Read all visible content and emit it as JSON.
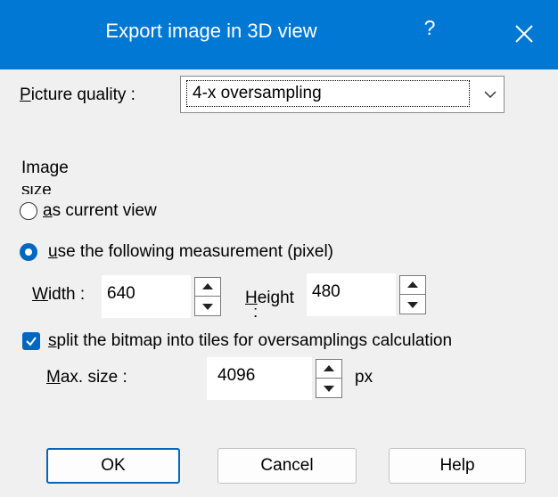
{
  "window": {
    "title": "Export image in 3D view",
    "help_glyph": "?",
    "close_icon": "close-icon",
    "accent_color": "#0078d4"
  },
  "picture_quality": {
    "label_prefix": "P",
    "label_rest": "icture quality :",
    "selected": "4-x oversampling"
  },
  "image_size": {
    "group_label": "Image",
    "group_label_cont": "size",
    "option_current": {
      "underlined": "a",
      "rest": "s current view",
      "selected": false
    },
    "option_measure": {
      "underlined": "u",
      "rest": "se the following measurement (pixel)",
      "selected": true
    }
  },
  "width": {
    "label_underlined": "W",
    "label_rest": "idth :",
    "value": "640"
  },
  "height": {
    "label_underlined": "H",
    "label_rest": "eight",
    "label_cont": ":",
    "value": "480"
  },
  "tiles": {
    "checked": true,
    "label_underlined": "s",
    "label_rest": "plit the bitmap into tiles for oversamplings calculation"
  },
  "max_size": {
    "label_underlined": "M",
    "label_rest": "ax. size :",
    "value": "4096",
    "unit": "px"
  },
  "buttons": {
    "ok": "OK",
    "cancel": "Cancel",
    "help": "Help"
  }
}
